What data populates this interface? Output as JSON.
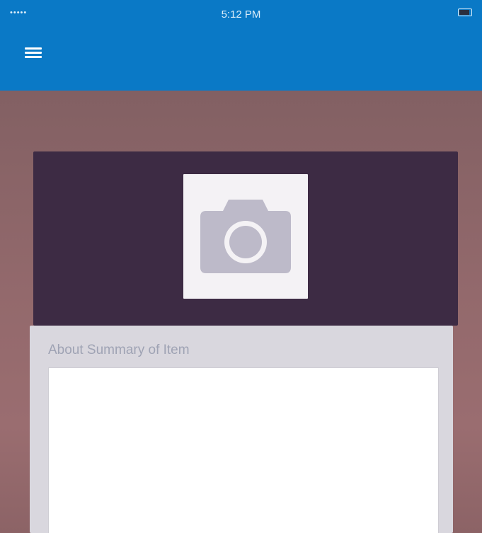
{
  "status_bar": {
    "signal": "•••••",
    "carrier": "",
    "time": "5:12 PM",
    "battery": "",
    "battery_level": 0.8
  },
  "nav_bar": {
    "menu_icon": "hamburger-menu-icon",
    "color": "#0a79c6"
  },
  "photo": {
    "icon": "camera-icon"
  },
  "summary": {
    "label": "About Summary of Item",
    "value": "",
    "placeholder": ""
  }
}
